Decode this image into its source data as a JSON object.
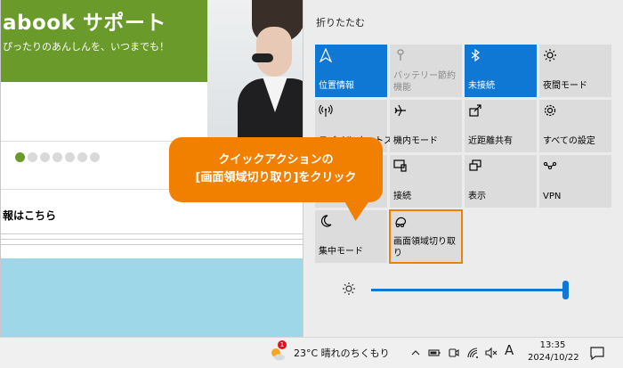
{
  "web": {
    "banner_title": "abook サポート",
    "banner_sub": "ぴったりのあんしんを、いつまでも！",
    "info_link": "報はこちら",
    "dot_count": 7,
    "active_dot": 0
  },
  "action_center": {
    "collapse_label": "折りたたむ",
    "tiles": [
      {
        "label": "位置情報",
        "icon": "location-icon",
        "state": "on"
      },
      {
        "label": "バッテリー節約機能",
        "icon": "battery-saver-icon",
        "state": "disabled"
      },
      {
        "label": "未接続",
        "icon": "bluetooth-icon",
        "state": "on"
      },
      {
        "label": "夜間モード",
        "icon": "night-light-icon",
        "state": "off"
      },
      {
        "label": "モバイル ホットス",
        "icon": "hotspot-icon",
        "state": "off"
      },
      {
        "label": "機内モード",
        "icon": "airplane-icon",
        "state": "off"
      },
      {
        "label": "近距離共有",
        "icon": "nearby-share-icon",
        "state": "off"
      },
      {
        "label": "すべての設定",
        "icon": "settings-gear-icon",
        "state": "off"
      },
      {
        "label": "",
        "icon": "",
        "state": "off"
      },
      {
        "label": "接続",
        "icon": "connect-icon",
        "state": "off"
      },
      {
        "label": "表示",
        "icon": "project-icon",
        "state": "off"
      },
      {
        "label": "VPN",
        "icon": "vpn-icon",
        "state": "off"
      },
      {
        "label": "集中モード",
        "icon": "focus-moon-icon",
        "state": "off"
      },
      {
        "label": "画面領域切り取り",
        "icon": "snip-icon",
        "state": "highlighted"
      }
    ],
    "brightness": 0.98
  },
  "callout": {
    "line1": "クイックアクションの",
    "line2": "[画面領域切り取り]をクリック"
  },
  "taskbar": {
    "weather_badge": "1",
    "weather_text": "23°C  晴れのちくもり",
    "ime": "A",
    "time": "13:35",
    "date": "2024/10/22"
  },
  "colors": {
    "accent": "#0f78d4",
    "callout": "#f28000",
    "banner": "#6a9a2a",
    "tile_bg": "#dcdcdc"
  }
}
